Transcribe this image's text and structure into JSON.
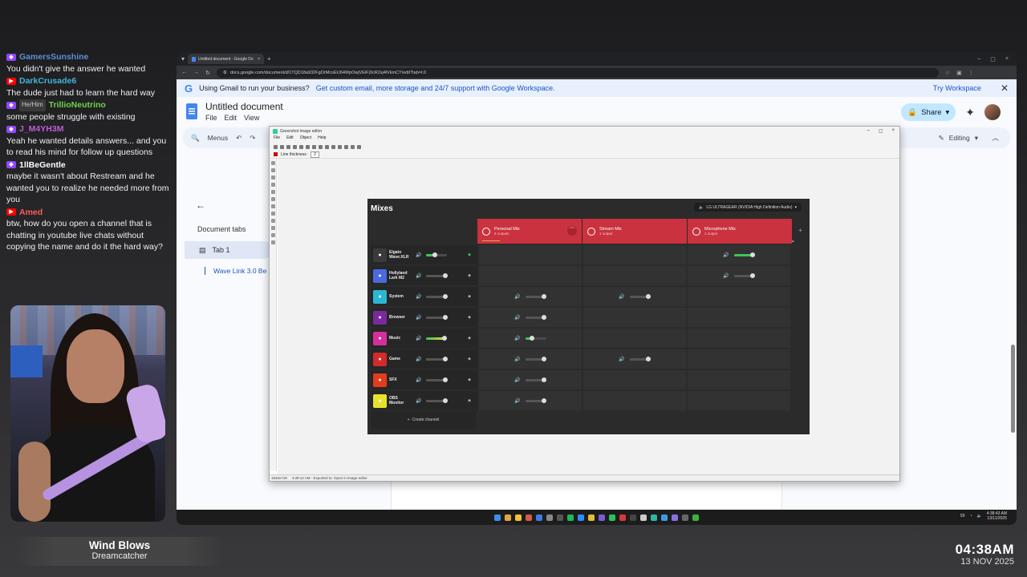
{
  "chat": {
    "messages": [
      {
        "platform": "twitch",
        "user": "GamersSunshine",
        "user_color": "#5b8fd6",
        "pronouns": "",
        "text": "You didn't give the answer he wanted"
      },
      {
        "platform": "yt",
        "user": "DarkCrusade6",
        "user_color": "#3fb7d9",
        "pronouns": "",
        "text": "The dude just had to learn the hard way"
      },
      {
        "platform": "twitch",
        "user": "TrillioNeutrino",
        "user_color": "#6fd24a",
        "pronouns": "He/Him",
        "text": "some people struggle with existing"
      },
      {
        "platform": "twitch",
        "user": "J_M4YH3M",
        "user_color": "#c35ad9",
        "pronouns": "",
        "text": "Yeah he wanted details answers... and you to read his mind for follow up questions"
      },
      {
        "platform": "twitch",
        "user": "1llBeGentle",
        "user_color": "#ffffff",
        "pronouns": "",
        "text": "maybe it wasn't about Restream and he wanted you to realize he needed more from you"
      },
      {
        "platform": "yt",
        "user": "Amed",
        "user_color": "#ff5a5a",
        "pronouns": "",
        "text": "btw, how do you open a channel that is chatting in youtube live chats without copying the name and do it the hard way?"
      }
    ]
  },
  "now_playing": {
    "song": "Wind Blows",
    "artist": "Dreamcatcher"
  },
  "clock": {
    "time": "04:38AM",
    "date": "13 NOV 2025"
  },
  "browser": {
    "tab_title": "Untitled document - Google Do",
    "url": "docs.google.com/document/d/1TQD18a932FgOrMcoEU64WpOwjVEiF|0cR2sj4lVkmCY/edit?tab=t.0"
  },
  "docs": {
    "banner_text": "Using Gmail to run your business?",
    "banner_sub": "Get custom email, more storage and 24/7 support with Google Workspace.",
    "banner_cta": "Try Workspace",
    "title": "Untitled document",
    "menus": [
      "File",
      "Edit",
      "View"
    ],
    "share_label": "Share",
    "toolbar_menus": "Menus",
    "editing_label": "Editing",
    "sidebar_heading": "Document tabs",
    "tab1": "Tab 1",
    "subtab": "Wave Link 3.0 Be"
  },
  "editor": {
    "title": "Greenshot image editor",
    "menu": [
      "File",
      "Edit",
      "Object",
      "Help"
    ],
    "line_thickness_label": "Line thickness:",
    "line_thickness_value": "2",
    "status_size": "1546x719",
    "status_time": "4:38:12 AM - Exported to: Open in image editor"
  },
  "mixer": {
    "title": "Mixes",
    "device": "LG ULTRAGEAR (NVIDIA High Definition Audio)",
    "mixes": [
      {
        "name": "Personal Mix",
        "sub": "6 outputs"
      },
      {
        "name": "Stream Mix",
        "sub": "1 output"
      },
      {
        "name": "Microphone Mix",
        "sub": "1 output"
      }
    ],
    "channels": [
      {
        "name": "Elgato Wave:XLR",
        "icon_color": "#3a3a3a",
        "level": 0.4,
        "meter": "green",
        "mixes": [
          false,
          false,
          true
        ]
      },
      {
        "name": "Hollyland Lark M2",
        "icon_color": "#4a6ae0",
        "level": 0.9,
        "meter": "",
        "mixes": [
          false,
          false,
          true
        ]
      },
      {
        "name": "System",
        "icon_color": "#2bb7d4",
        "level": 0.9,
        "meter": "",
        "mixes": [
          true,
          true,
          false
        ]
      },
      {
        "name": "Browser",
        "icon_color": "#7a2a9c",
        "level": 0.9,
        "meter": "",
        "mixes": [
          true,
          false,
          false
        ]
      },
      {
        "name": "Music",
        "icon_color": "#d42f9a",
        "level": 0.85,
        "meter": "yellow",
        "mixes": [
          true,
          false,
          false
        ]
      },
      {
        "name": "Game",
        "icon_color": "#d42a2a",
        "level": 0.9,
        "meter": "",
        "mixes": [
          true,
          true,
          false
        ]
      },
      {
        "name": "SFX",
        "icon_color": "#e23c1e",
        "level": 0.9,
        "meter": "",
        "mixes": [
          true,
          false,
          false
        ]
      },
      {
        "name": "OBS Monitor",
        "icon_color": "#e8e22c",
        "level": 0.9,
        "meter": "",
        "mixes": [
          true,
          false,
          false
        ]
      }
    ],
    "create_label": "Create channel"
  },
  "tray": {
    "temp": "59",
    "time": "4:38:43 AM",
    "date": "13/11/2025"
  }
}
